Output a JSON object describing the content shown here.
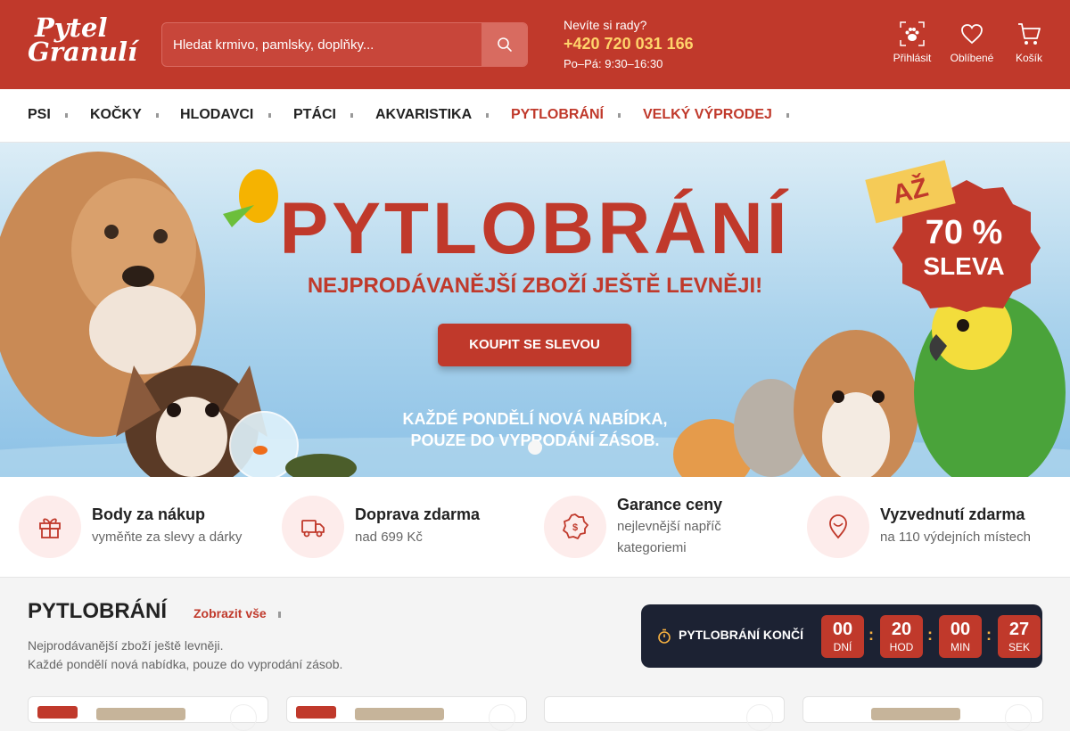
{
  "logo": {
    "line1": "Pytel",
    "line2": "Granulí"
  },
  "search": {
    "placeholder": "Hledat krmivo, pamlsky, doplňky..."
  },
  "help": {
    "question": "Nevíte si rady?",
    "phone": "+420 720 031 166",
    "hours": "Po–Pá: 9:30–16:30"
  },
  "header_actions": {
    "login": "Přihlásit",
    "favorites": "Oblíbené",
    "cart": "Košík"
  },
  "nav": [
    {
      "label": "PSI"
    },
    {
      "label": "KOČKY"
    },
    {
      "label": "HLODAVCI"
    },
    {
      "label": "PTÁCI"
    },
    {
      "label": "AKVARISTIKA"
    },
    {
      "label": "PYTLOBRÁNÍ"
    },
    {
      "label": "VELKÝ VÝPRODEJ"
    }
  ],
  "hero": {
    "title": "PYTLOBRÁNÍ",
    "subtitle": "NEJPRODÁVANĚJŠÍ ZBOŽÍ JEŠTĚ LEVNĚJI!",
    "cta": "KOUPIT SE SLEVOU",
    "note_line1": "KAŽDÉ PONDĚLÍ NOVÁ NABÍDKA,",
    "note_line2": "POUZE DO VYPRODÁNÍ ZÁSOB.",
    "badge_top": "AŽ",
    "badge_percent": "70 %",
    "badge_word": "SLEVA",
    "accent_color": "#c0392b",
    "badge_yellow": "#f5cb57"
  },
  "benefits": [
    {
      "title": "Body za nákup",
      "desc": "vyměňte za slevy a dárky",
      "icon": "gift-icon"
    },
    {
      "title": "Doprava zdarma",
      "desc": "nad 699 Kč",
      "icon": "truck-icon"
    },
    {
      "title": "Garance ceny",
      "desc": "nejlevnější napříč kategoriemi",
      "icon": "price-badge-icon"
    },
    {
      "title": "Vyzvednutí zdarma",
      "desc": "na 110 výdejních místech",
      "icon": "pin-icon"
    }
  ],
  "section": {
    "title": "PYTLOBRÁNÍ",
    "link": "Zobrazit vše",
    "desc_line1": "Nejprodávanější zboží ještě levněji.",
    "desc_line2": "Každé pondělí nová nabídka, pouze do vyprodání zásob."
  },
  "countdown": {
    "label": "PYTLOBRÁNÍ KONČÍ",
    "units": [
      {
        "value": "00",
        "unit": "DNÍ"
      },
      {
        "value": "20",
        "unit": "HOD"
      },
      {
        "value": "00",
        "unit": "MIN"
      },
      {
        "value": "27",
        "unit": "SEK"
      }
    ]
  }
}
